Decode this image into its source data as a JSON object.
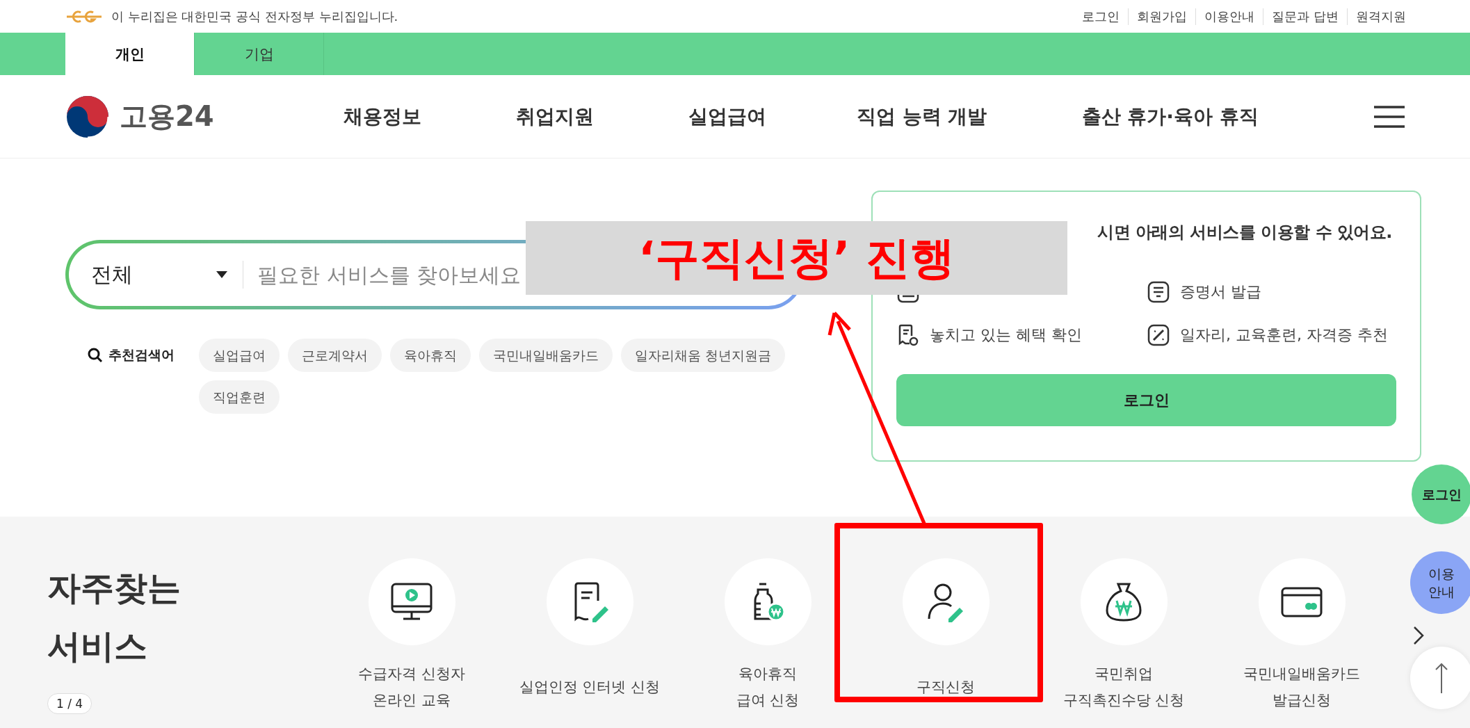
{
  "notice": {
    "text": "이 누리집은 대한민국 공식 전자정부 누리집입니다."
  },
  "util_links": [
    "로그인",
    "회원가입",
    "이용안내",
    "질문과 답변",
    "원격지원"
  ],
  "tabs": [
    {
      "label": "개인",
      "selected": true
    },
    {
      "label": "기업",
      "selected": false
    }
  ],
  "logo": {
    "text": "고용24"
  },
  "nav": [
    "채용정보",
    "취업지원",
    "실업급여",
    "직업 능력 개발",
    "출산 휴가·육아 휴직"
  ],
  "search": {
    "category": "전체",
    "placeholder": "필요한 서비스를 찾아보세요"
  },
  "recommended": {
    "label": "추천검색어",
    "keywords": [
      "실업급여",
      "근로계약서",
      "육아휴직",
      "국민내일배움카드",
      "일자리채움 청년지원금",
      "직업훈련"
    ]
  },
  "login_card": {
    "title": "시면 아래의 서비스를 이용할 수 있어요.",
    "features": [
      "증명서 발급",
      "놓치고 있는 혜택 확인",
      "일자리, 교육훈련, 자격증 추천"
    ],
    "button": "로그인"
  },
  "annotation": {
    "callout": "‘구직신청’ 진행"
  },
  "frequent": {
    "title": "자주찾는 서비스",
    "pager": "1 / 4",
    "services": [
      {
        "label": "수급자격 신청자\n온라인 교육",
        "highlighted": false
      },
      {
        "label": "실업인정 인터넷 신청",
        "highlighted": false
      },
      {
        "label": "육아휴직\n급여 신청",
        "highlighted": false
      },
      {
        "label": "구직신청",
        "highlighted": true
      },
      {
        "label": "국민취업\n구직촉진수당 신청",
        "highlighted": false
      },
      {
        "label": "국민내일배움카드\n발급신청",
        "highlighted": false
      }
    ]
  },
  "side_buttons": [
    {
      "label": "로그인",
      "color": "#63d491"
    },
    {
      "label": "이용\n안내",
      "color": "#8aa5f5"
    }
  ]
}
